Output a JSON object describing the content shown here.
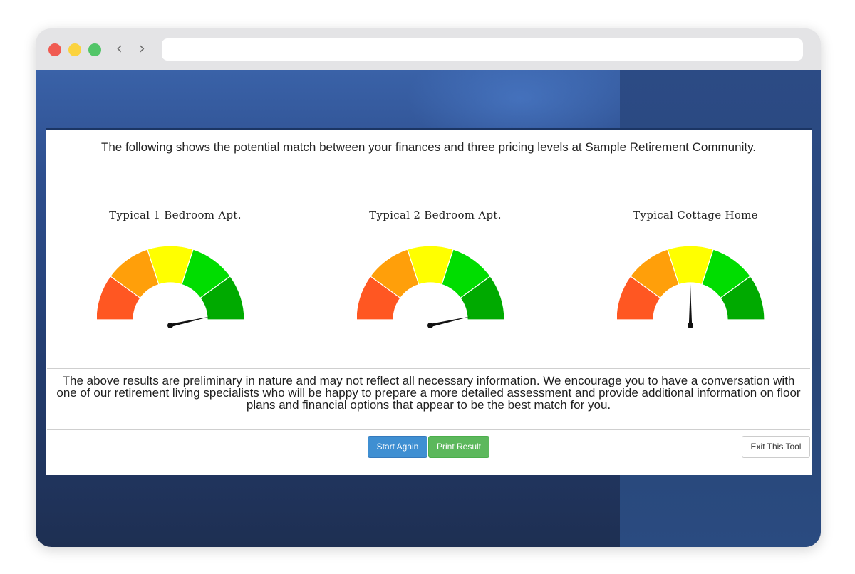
{
  "browser": {
    "back_glyph": "‹",
    "forward_glyph": "›"
  },
  "page": {
    "intro": "The following shows the potential match between your finances and three pricing levels at Sample Retirement Community.",
    "disclaimer_lines": [
      "The above results are preliminary in nature and may not reflect all necessary information. We encourage you to have a conversation with",
      "one of our retirement living specialists who will be happy to prepare a more detailed assessment and provide additional information on floor",
      "plans and financial options that appear to be the best match for you."
    ]
  },
  "gauges": [
    {
      "title": "Typical 1 Bedroom Apt.",
      "value_fraction": 0.93
    },
    {
      "title": "Typical 2 Bedroom Apt.",
      "value_fraction": 0.93
    },
    {
      "title": "Typical Cottage Home",
      "value_fraction": 0.5
    }
  ],
  "gauge_colors": [
    "#ff5722",
    "#ff9f0a",
    "#ffff00",
    "#00dd00",
    "#00aa00"
  ],
  "buttons": {
    "start_again": "Start Again",
    "print_result": "Print Result",
    "exit_tool": "Exit This Tool"
  }
}
